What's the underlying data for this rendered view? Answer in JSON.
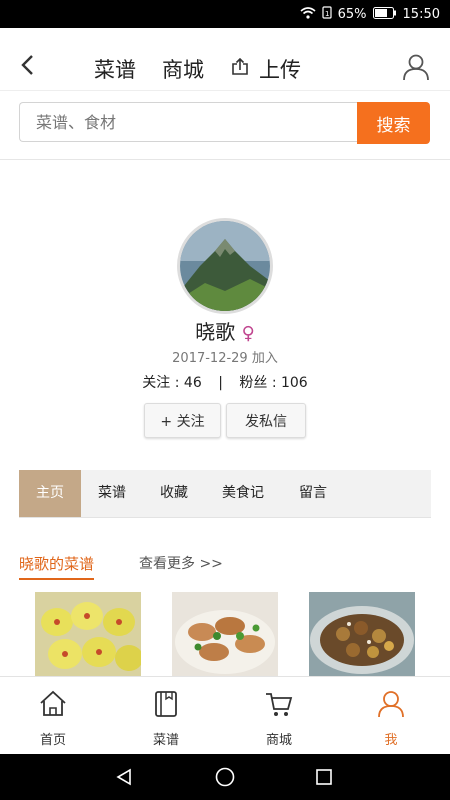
{
  "status_bar": {
    "battery": "65%",
    "time": "15:50"
  },
  "top_nav": {
    "tabs": [
      "菜谱",
      "商城",
      "上传"
    ]
  },
  "search": {
    "placeholder": "菜谱、食材",
    "button_label": "搜索"
  },
  "profile": {
    "name": "晓歌",
    "gender_symbol": "♀",
    "joined": "2017-12-29 加入",
    "follow_label": "关注",
    "follow_count": "46",
    "separator": "|",
    "fans_label": "粉丝",
    "fans_count": "106",
    "follow_button": "+ 关注",
    "message_button": "发私信"
  },
  "tabs": [
    "主页",
    "菜谱",
    "收藏",
    "美食记",
    "留言"
  ],
  "section": {
    "title": "晓歌的菜谱",
    "see_more": "查看更多 >>"
  },
  "bottom_nav": [
    "首页",
    "菜谱",
    "商城",
    "我"
  ],
  "colors": {
    "accent": "#f5701e",
    "active_tab": "#c4a888",
    "gender": "#c0458f"
  }
}
